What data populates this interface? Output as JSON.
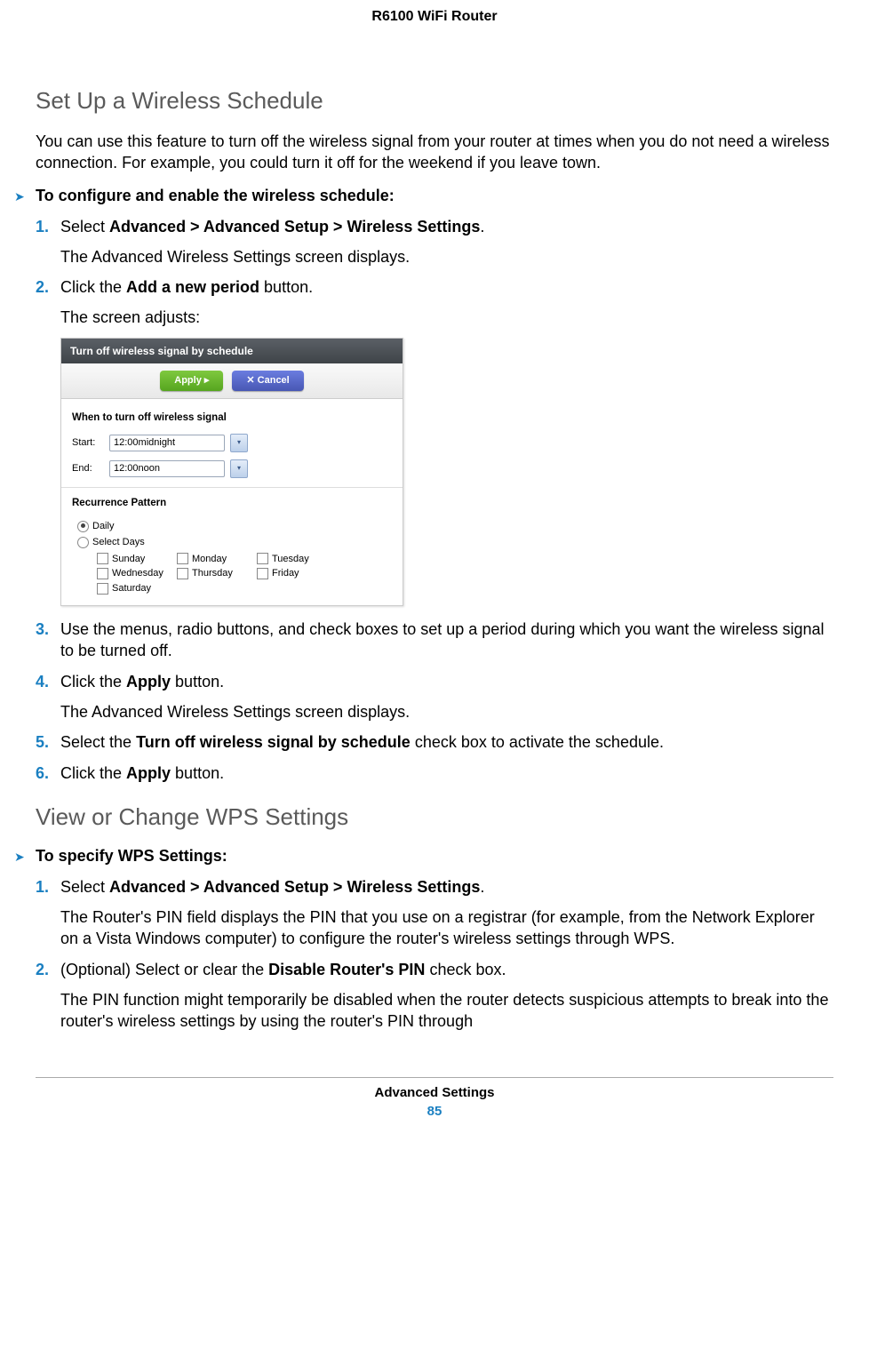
{
  "header": {
    "doc_title": "R6100 WiFi Router"
  },
  "section1": {
    "heading": "Set Up a Wireless Schedule",
    "intro": "You can use this feature to turn off the wireless signal from your router at times when you do not need a wireless connection. For example, you could turn it off for the weekend if you leave town.",
    "procedure_title": "To configure and enable the wireless schedule:",
    "steps": {
      "s1_pre": "Select ",
      "s1_bold": "Advanced > Advanced Setup > Wireless Settings",
      "s1_post": ".",
      "s1_follow": "The Advanced Wireless Settings screen displays.",
      "s2_pre": "Click the ",
      "s2_bold": "Add a new period",
      "s2_post": " button.",
      "s2_follow": "The screen adjusts:",
      "s3": "Use the menus, radio buttons, and check boxes to set up a period during which you want the wireless signal to be turned off.",
      "s4_pre": "Click the ",
      "s4_bold": "Apply",
      "s4_post": " button.",
      "s4_follow": "The Advanced Wireless Settings screen displays.",
      "s5_pre": "Select the ",
      "s5_bold": "Turn off wireless signal by schedule",
      "s5_post": " check box to activate the schedule.",
      "s6_pre": "Click the ",
      "s6_bold": "Apply",
      "s6_post": " button."
    }
  },
  "widget": {
    "title": "Turn off wireless signal by schedule",
    "apply": "Apply ▸",
    "cancel": "✕ Cancel",
    "when_label": "When to turn off wireless signal",
    "start_label": "Start:",
    "start_value": "12:00midnight",
    "end_label": "End:",
    "end_value": "12:00noon",
    "recurrence_label": "Recurrence Pattern",
    "daily": "Daily",
    "select_days": "Select Days",
    "days": [
      "Sunday",
      "Monday",
      "Tuesday",
      "Wednesday",
      "Thursday",
      "Friday",
      "Saturday"
    ]
  },
  "section2": {
    "heading": "View or Change WPS Settings",
    "procedure_title": "To specify WPS Settings:",
    "steps": {
      "s1_pre": "Select ",
      "s1_bold": "Advanced > Advanced Setup > Wireless Settings",
      "s1_post": ".",
      "s1_follow": "The Router's PIN field displays the PIN that you use on a registrar (for example, from the Network Explorer on a Vista Windows computer) to configure the router's wireless settings through WPS.",
      "s2_pre": "(Optional) Select or clear the ",
      "s2_bold": "Disable Router's PIN",
      "s2_post": " check box.",
      "s2_follow": "The PIN function might temporarily be disabled when the router detects suspicious attempts to break into the router's wireless settings by using the router's PIN through"
    }
  },
  "footer": {
    "chapter": "Advanced Settings",
    "page": "85"
  }
}
